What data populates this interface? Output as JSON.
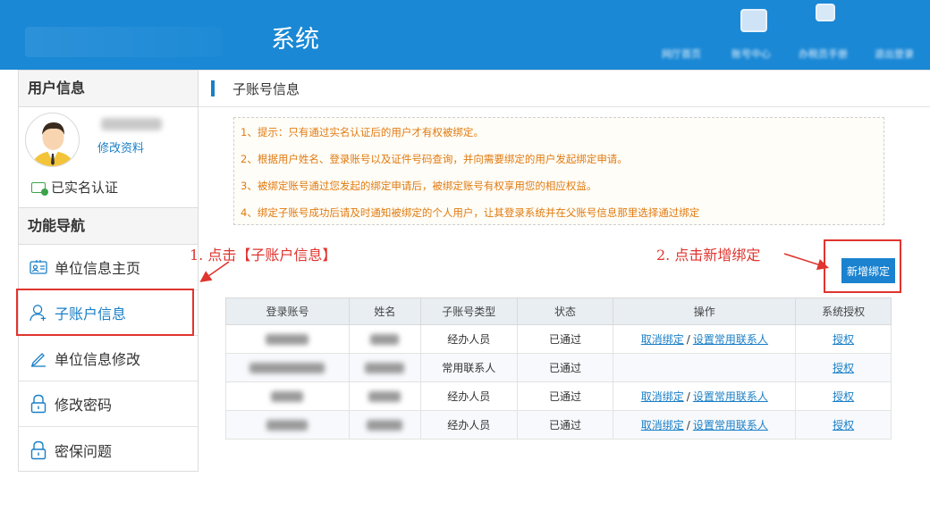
{
  "header": {
    "title": "系统",
    "links": [
      "网厅首页",
      "账号中心",
      "办税员手册",
      "退出登录"
    ]
  },
  "sidebar": {
    "user_section_title": "用户信息",
    "edit_profile_label": "修改资料",
    "verified_label": "已实名认证",
    "nav_section_title": "功能导航",
    "items": [
      {
        "label": "单位信息主页",
        "icon": "id-card-icon"
      },
      {
        "label": "子账户信息",
        "icon": "user-add-icon",
        "active": true
      },
      {
        "label": "单位信息修改",
        "icon": "pencil-icon"
      },
      {
        "label": "修改密码",
        "icon": "lock-icon"
      },
      {
        "label": "密保问题",
        "icon": "lock-icon"
      }
    ]
  },
  "main": {
    "breadcrumb_title": "子账号信息",
    "notices": [
      "1、提示：只有通过实名认证后的用户才有权被绑定。",
      "2、根据用户姓名、登录账号以及证件号码查询，并向需要绑定的用户发起绑定申请。",
      "3、被绑定账号通过您发起的绑定申请后，被绑定账号有权享用您的相应权益。",
      "4、绑定子账号成功后请及时通知被绑定的个人用户，让其登录系统并在父账号信息那里选择通过绑定"
    ],
    "add_binding_label": "新增绑定",
    "annotations": {
      "step1": "1. 点击【子账户信息】",
      "step2": "2. 点击新增绑定"
    },
    "table": {
      "headers": [
        "登录账号",
        "姓名",
        "子账号类型",
        "状态",
        "操作",
        "系统授权"
      ],
      "rows": [
        {
          "type": "经办人员",
          "status": "已通过",
          "ops": [
            "取消绑定",
            "设置常用联系人"
          ],
          "auth": "授权"
        },
        {
          "type": "常用联系人",
          "status": "已通过",
          "ops": [],
          "auth": "授权"
        },
        {
          "type": "经办人员",
          "status": "已通过",
          "ops": [
            "取消绑定",
            "设置常用联系人"
          ],
          "auth": "授权"
        },
        {
          "type": "经办人员",
          "status": "已通过",
          "ops": [
            "取消绑定",
            "设置常用联系人"
          ],
          "auth": "授权"
        }
      ],
      "op_separator": "/"
    }
  },
  "colors": {
    "header_bg": "#1a88d5",
    "accent": "#1a7fc6",
    "notice_text": "#e07b12",
    "annotation_red": "#e0342e"
  }
}
